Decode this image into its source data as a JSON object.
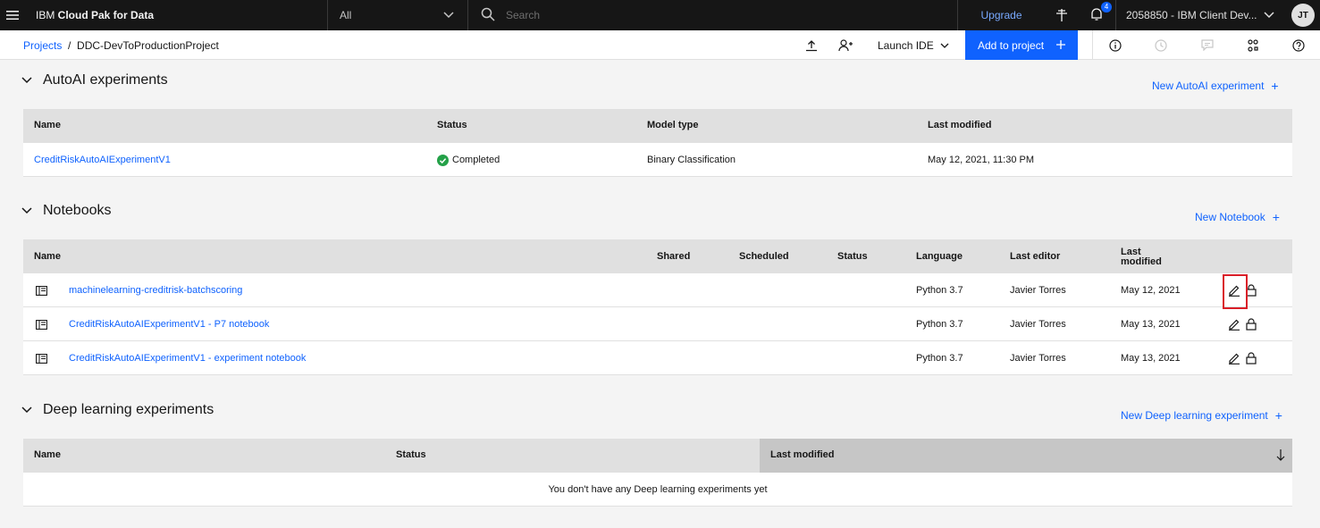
{
  "topbar": {
    "brand_prefix": "IBM ",
    "brand_name": "Cloud Pak for Data",
    "scope_value": "All",
    "search_placeholder": "Search",
    "upgrade_label": "Upgrade",
    "notification_count": "4",
    "account_name": "2058850 - IBM Client Dev...",
    "avatar_initials": "JT"
  },
  "subbar": {
    "breadcrumb_root": "Projects",
    "breadcrumb_sep": "/",
    "breadcrumb_current": "DDC-DevToProductionProject",
    "launch_ide": "Launch IDE",
    "add_to_project": "Add to project"
  },
  "autoai": {
    "title": "AutoAI experiments",
    "new_link": "New AutoAI experiment",
    "headers": {
      "name": "Name",
      "status": "Status",
      "model_type": "Model type",
      "last_modified": "Last modified"
    },
    "rows": [
      {
        "name": "CreditRiskAutoAIExperimentV1",
        "status": "Completed",
        "model_type": "Binary Classification",
        "last_modified": "May 12, 2021, 11:30 PM"
      }
    ]
  },
  "notebooks": {
    "title": "Notebooks",
    "new_link": "New Notebook",
    "headers": {
      "name": "Name",
      "shared": "Shared",
      "scheduled": "Scheduled",
      "status": "Status",
      "language": "Language",
      "last_editor": "Last editor",
      "last_modified_1": "Last",
      "last_modified_2": "modified"
    },
    "rows": [
      {
        "name": "machinelearning-creditrisk-batchscoring",
        "language": "Python 3.7",
        "last_editor": "Javier Torres",
        "last_modified": "May 12, 2021"
      },
      {
        "name": "CreditRiskAutoAIExperimentV1 - P7 notebook",
        "language": "Python 3.7",
        "last_editor": "Javier Torres",
        "last_modified": "May 13, 2021"
      },
      {
        "name": "CreditRiskAutoAIExperimentV1 - experiment notebook",
        "language": "Python 3.7",
        "last_editor": "Javier Torres",
        "last_modified": "May 13, 2021"
      }
    ]
  },
  "deep": {
    "title": "Deep learning experiments",
    "new_link": "New Deep learning experiment",
    "headers": {
      "name": "Name",
      "status": "Status",
      "last_modified": "Last modified"
    },
    "empty_text": "You don't have any Deep learning experiments yet"
  },
  "colors": {
    "accent": "#0f62fe",
    "topbar": "#161616",
    "success": "#24a148",
    "highlight": "#da1e28"
  },
  "icons": [
    "menu-icon",
    "chevron-down-icon",
    "search-icon",
    "pin-icon",
    "bell-icon",
    "upload-icon",
    "add-user-icon",
    "plus-icon",
    "info-icon",
    "history-icon",
    "comment-icon",
    "settings-adjust-icon",
    "help-icon",
    "notebook-icon",
    "edit-icon",
    "lock-icon",
    "checkmark-icon",
    "sort-arrow-down-icon"
  ]
}
